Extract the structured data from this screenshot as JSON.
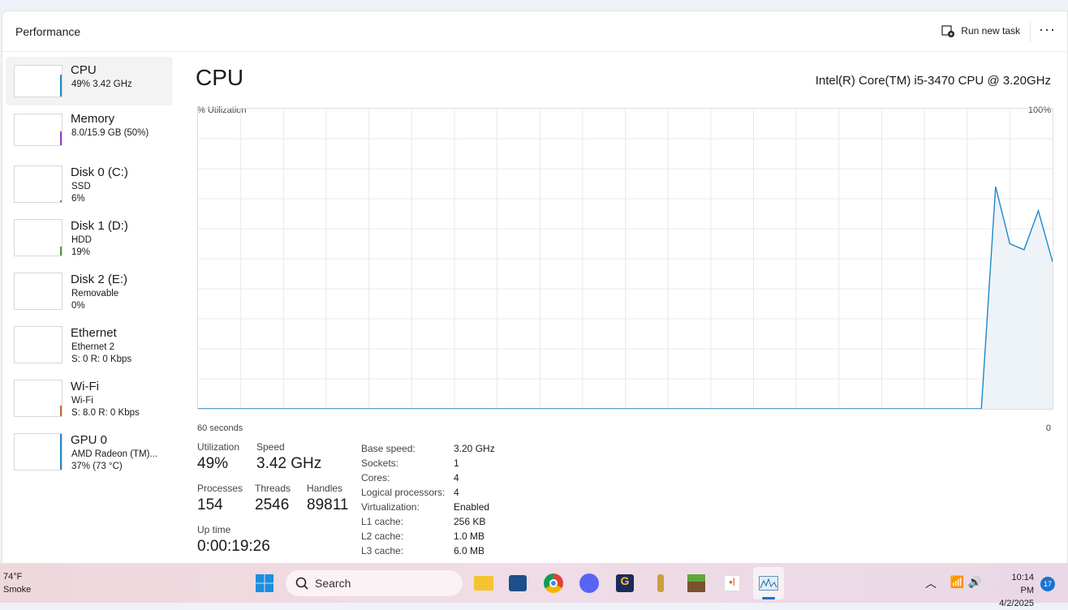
{
  "header": {
    "title": "Performance",
    "run_new_task": "Run new task",
    "more": "···"
  },
  "sidebar": {
    "items": [
      {
        "name": "CPU",
        "l1": "49% 3.42 GHz",
        "color": "#1e88c8"
      },
      {
        "name": "Memory",
        "l1": "8.0/15.9 GB (50%)",
        "color": "#9b3fc0"
      },
      {
        "name": "Disk 0 (C:)",
        "l1": "SSD",
        "l2": "6%",
        "color": "#4c9a2a"
      },
      {
        "name": "Disk 1 (D:)",
        "l1": "HDD",
        "l2": "19%",
        "color": "#4c9a2a"
      },
      {
        "name": "Disk 2 (E:)",
        "l1": "Removable",
        "l2": "0%",
        "color": "#4c9a2a"
      },
      {
        "name": "Ethernet",
        "l1": "Ethernet 2",
        "l2": "S: 0 R: 0 Kbps",
        "color": "#c8642b"
      },
      {
        "name": "Wi-Fi",
        "l1": "Wi-Fi",
        "l2": "S: 8.0 R: 0 Kbps",
        "color": "#c8642b"
      },
      {
        "name": "GPU 0",
        "l1": "AMD Radeon (TM)...",
        "l2": "37% (73 °C)",
        "color": "#1e88c8"
      }
    ]
  },
  "main": {
    "title": "CPU",
    "model": "Intel(R) Core(TM) i5-3470 CPU @ 3.20GHz",
    "y_label": "% Utilization",
    "y_max": "100%",
    "x_label": "60 seconds",
    "x_min": "0",
    "stats": {
      "utilization_k": "Utilization",
      "utilization": "49%",
      "speed_k": "Speed",
      "speed": "3.42 GHz",
      "processes_k": "Processes",
      "processes": "154",
      "threads_k": "Threads",
      "threads": "2546",
      "handles_k": "Handles",
      "handles": "89811",
      "uptime_k": "Up time",
      "uptime": "0:00:19:26"
    },
    "specs": [
      [
        "Base speed:",
        "3.20 GHz"
      ],
      [
        "Sockets:",
        "1"
      ],
      [
        "Cores:",
        "4"
      ],
      [
        "Logical processors:",
        "4"
      ],
      [
        "Virtualization:",
        "Enabled"
      ],
      [
        "L1 cache:",
        "256 KB"
      ],
      [
        "L2 cache:",
        "1.0 MB"
      ],
      [
        "L3 cache:",
        "6.0 MB"
      ]
    ]
  },
  "chart_data": {
    "type": "area",
    "title": "CPU % Utilization",
    "xlabel": "60 seconds",
    "ylim": [
      0,
      100
    ],
    "xlim": [
      60,
      0
    ],
    "x": [
      60,
      6,
      5,
      4,
      3,
      2,
      1,
      0
    ],
    "values": [
      0,
      0,
      0,
      74,
      55,
      53,
      66,
      49
    ],
    "color": "#1e88c8"
  },
  "taskbar": {
    "weather_temp": "74°F",
    "weather_desc": "Smoke",
    "search": "Search",
    "time": "10:14 PM",
    "date": "4/2/2025",
    "notif_count": "17"
  }
}
